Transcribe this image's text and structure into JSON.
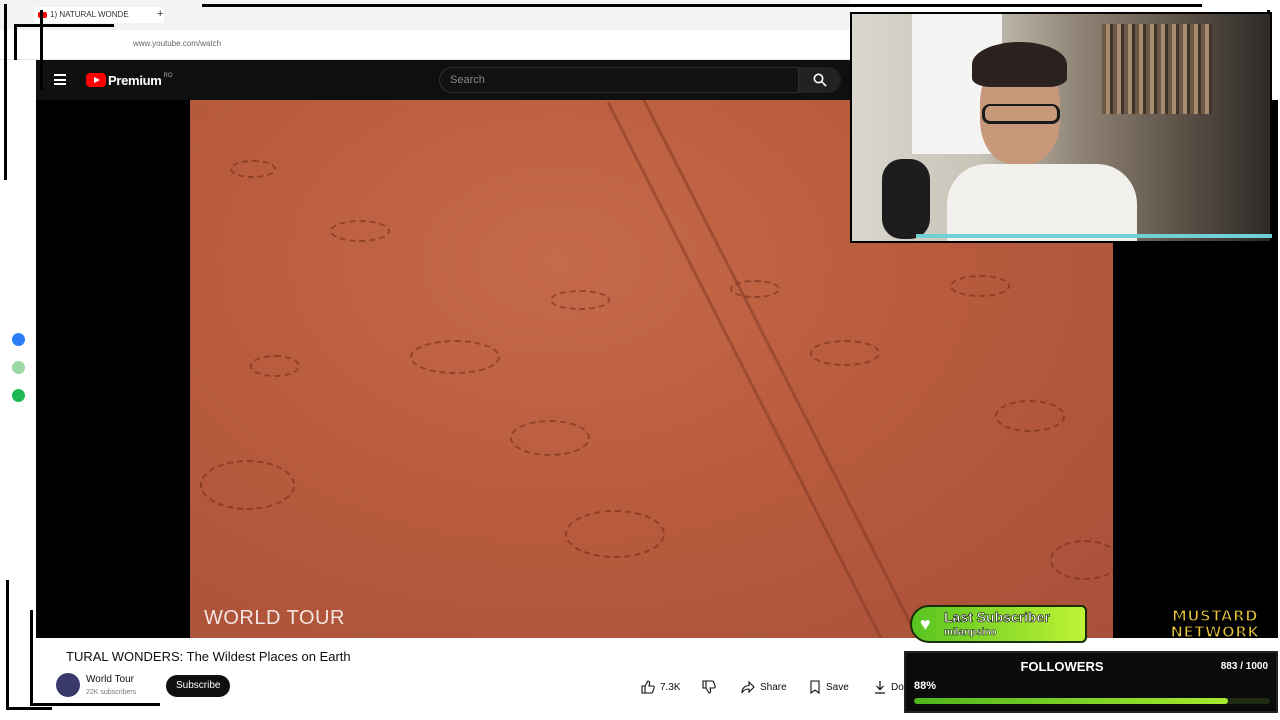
{
  "browser": {
    "tab_title": "1) NATURAL WONDE",
    "new_tab_label": "+",
    "url": "www.youtube.com/watch"
  },
  "youtube": {
    "logo_text": "Premium",
    "logo_region": "RO",
    "search_placeholder": "Search",
    "video": {
      "caption": "WORLD TOUR",
      "title": "TURAL WONDERS: The Wildest Places on Earth"
    },
    "channel": {
      "name": "World Tour",
      "subscribers": "22K subscribers",
      "subscribe_label": "Subscribe"
    },
    "actions": {
      "like_count": "7.3K",
      "share_label": "Share",
      "save_label": "Save",
      "download_label": "Do"
    }
  },
  "overlay": {
    "last_subscriber_label": "Last Subscriber",
    "last_subscriber_name": "milanpsino",
    "brand_line1": "MUSTARD",
    "brand_line2": "NETWORK",
    "followers": {
      "title": "FOLLOWERS",
      "count_text": "883 / 1000",
      "percent_text": "88%",
      "progress": 0.883
    },
    "colors": {
      "accent_green": "#59c320",
      "brand_yellow": "#e8c63a",
      "youtube_red": "#ff0000"
    },
    "side_icons": [
      "messenger-icon",
      "whatsapp-icon",
      "spotify-icon"
    ]
  }
}
